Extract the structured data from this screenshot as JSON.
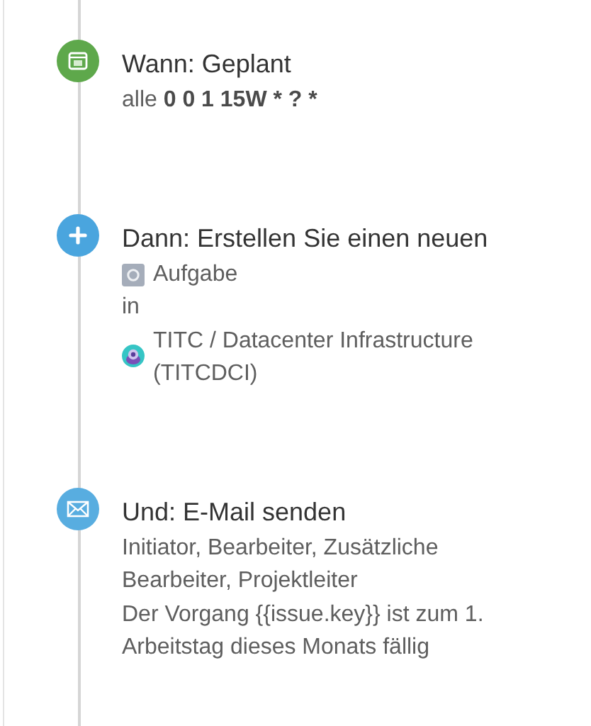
{
  "steps": [
    {
      "kind": "schedule",
      "title": "Wann: Geplant",
      "prefix": "alle",
      "value": "0 0 1 15W * ? *"
    },
    {
      "kind": "create",
      "title": "Dann: Erstellen Sie einen neuen",
      "issue_type": "Aufgabe",
      "connector": "in",
      "project": "TITC / Datacenter Infrastructure (TITCDCI)"
    },
    {
      "kind": "email",
      "title": "Und: E-Mail senden",
      "recipients": "Initiator, Bearbeiter, Zusätzliche Bearbeiter, Projektleiter",
      "message": "Der Vorgang {{issue.key}} ist zum 1. Arbeitstag dieses Monats fällig"
    }
  ]
}
